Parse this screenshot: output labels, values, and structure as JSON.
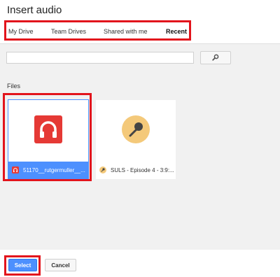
{
  "dialog": {
    "title": "Insert audio"
  },
  "tabs": [
    {
      "label": "My Drive",
      "active": false
    },
    {
      "label": "Team Drives",
      "active": false
    },
    {
      "label": "Shared with me",
      "active": false
    },
    {
      "label": "Recent",
      "active": true
    }
  ],
  "search": {
    "value": "",
    "placeholder": "",
    "button_icon": "search-icon"
  },
  "files_section": {
    "label": "Files"
  },
  "files": [
    {
      "name": "51170__rutgermuller__...",
      "icon": "headphones-icon",
      "selected": true
    },
    {
      "name": "SULS - Episode 4 - 3:9:...",
      "icon": "microphone-icon",
      "selected": false
    }
  ],
  "footer": {
    "select_label": "Select",
    "cancel_label": "Cancel"
  },
  "colors": {
    "annotation_red": "#e2141c",
    "accent_blue": "#4d90fe",
    "audio_red": "#e53935",
    "mic_circle": "#f4c97a"
  }
}
